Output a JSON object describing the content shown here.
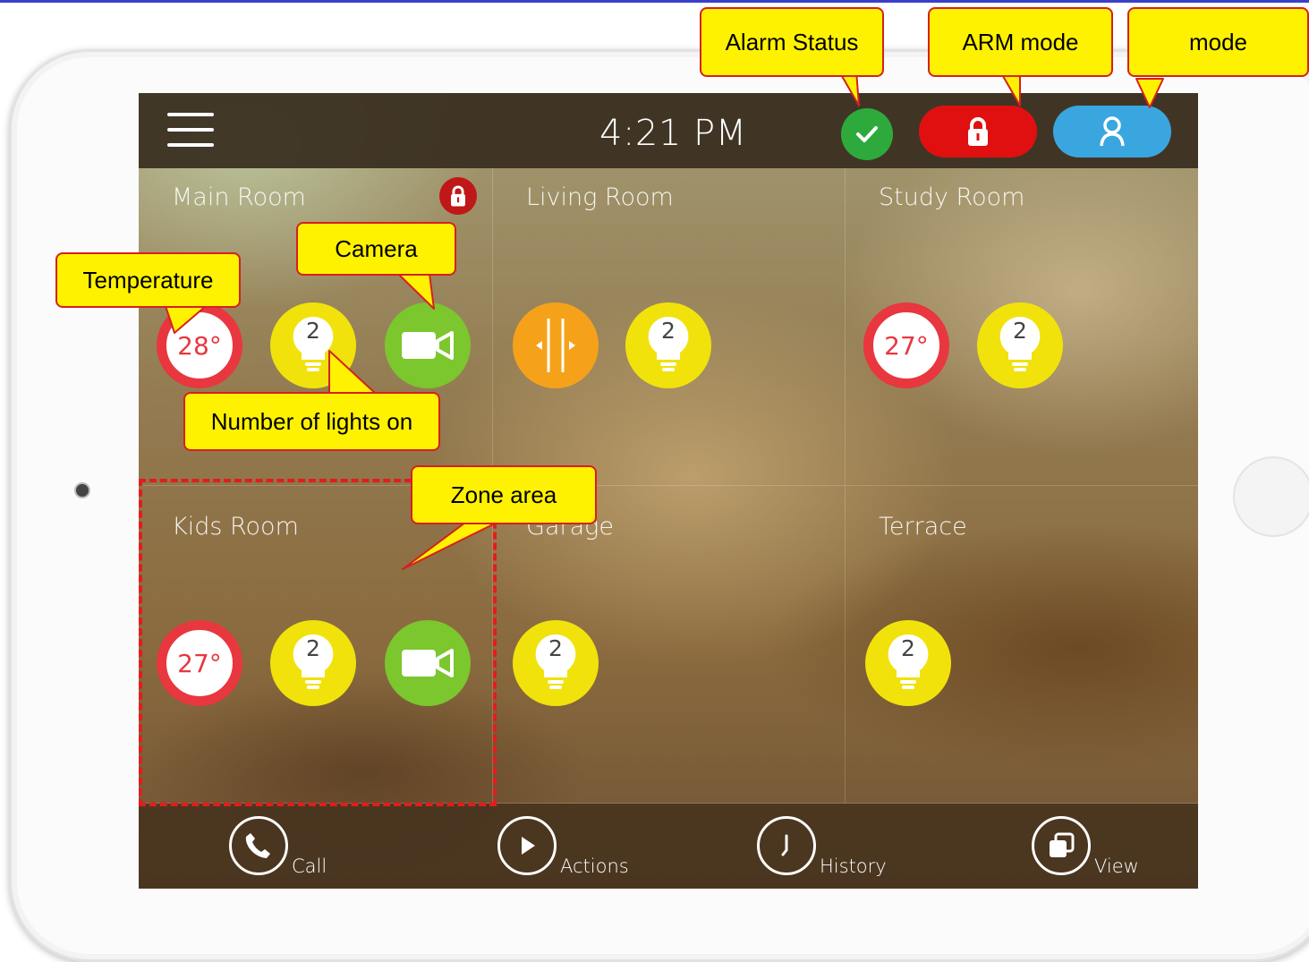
{
  "topbar": {
    "time": "4:21 PM",
    "menu_icon": "hamburger-menu-icon",
    "alarm_status_icon": "checkmark-icon",
    "arm_icon": "lock-icon",
    "mode_icon": "user-icon",
    "colors": {
      "alarm_ok": "#2eaa3c",
      "armed": "#e01010",
      "mode": "#3aa6e0"
    }
  },
  "zones": [
    {
      "name": "Main Room",
      "locked": true,
      "devices": [
        {
          "type": "temperature",
          "value": "28°"
        },
        {
          "type": "light",
          "count": "2"
        },
        {
          "type": "camera"
        }
      ]
    },
    {
      "name": "Living Room",
      "devices": [
        {
          "type": "blinds"
        },
        {
          "type": "light",
          "count": "2"
        }
      ]
    },
    {
      "name": "Study Room",
      "devices": [
        {
          "type": "temperature",
          "value": "27°"
        },
        {
          "type": "light",
          "count": "2"
        }
      ]
    },
    {
      "name": "Kids Room",
      "devices": [
        {
          "type": "temperature",
          "value": "27°"
        },
        {
          "type": "light",
          "count": "2"
        },
        {
          "type": "camera"
        }
      ]
    },
    {
      "name": "Garage",
      "devices": [
        {
          "type": "light",
          "count": "2"
        }
      ]
    },
    {
      "name": "Terrace",
      "devices": [
        {
          "type": "light",
          "count": "2"
        }
      ]
    }
  ],
  "bottom_nav": [
    {
      "label": "Call",
      "icon": "phone-icon"
    },
    {
      "label": "Actions",
      "icon": "play-icon"
    },
    {
      "label": "History",
      "icon": "clock-icon"
    },
    {
      "label": "View",
      "icon": "stacked-windows-icon"
    }
  ],
  "callouts": {
    "alarm_status": "Alarm Status",
    "arm_mode": "ARM mode",
    "mode": "mode",
    "temperature": "Temperature",
    "camera": "Camera",
    "lights": "Number of lights on",
    "zone_area": "Zone area"
  }
}
